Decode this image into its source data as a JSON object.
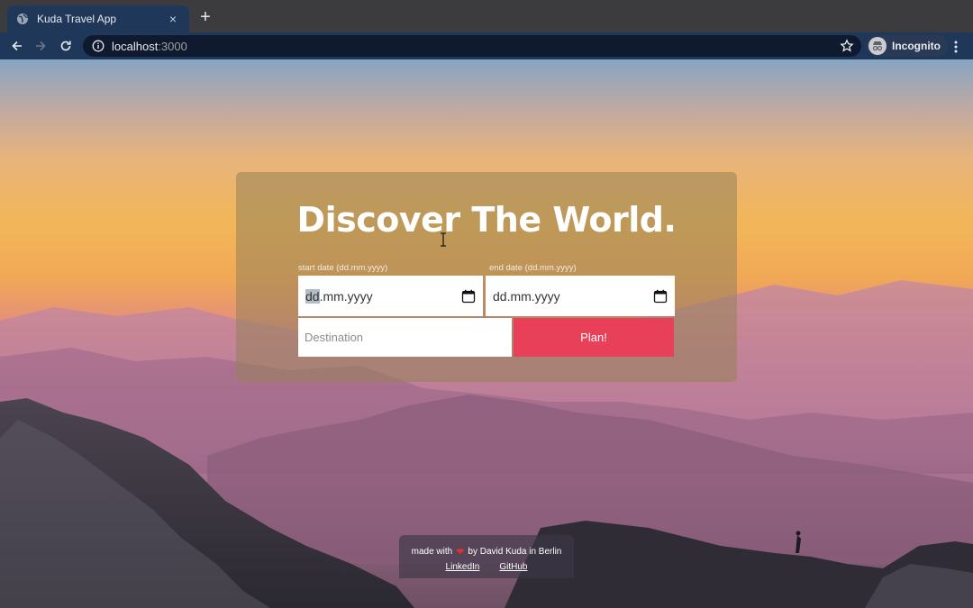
{
  "browser": {
    "tab_title": "Kuda Travel App",
    "tab_close": "×",
    "new_tab": "+",
    "url_host": "localhost",
    "url_port": ":3000",
    "profile_label": "Incognito"
  },
  "hero": {
    "title": "Discover The World."
  },
  "form": {
    "start_label": "start date (dd.mm.yyyy)",
    "end_label": "end date (dd.mm.yyyy)",
    "start_value_highlight": "dd",
    "start_value_rest": ".mm.yyyy",
    "end_value": "dd.mm.yyyy",
    "destination_placeholder": "Destination",
    "plan_label": "Plan!"
  },
  "footer": {
    "made_with": "made with",
    "heart": "❤",
    "by_text": "by David Kuda in Berlin",
    "links": [
      "LinkedIn",
      "GitHub"
    ]
  },
  "colors": {
    "accent": "#e84058",
    "chrome": "#1f3759"
  }
}
